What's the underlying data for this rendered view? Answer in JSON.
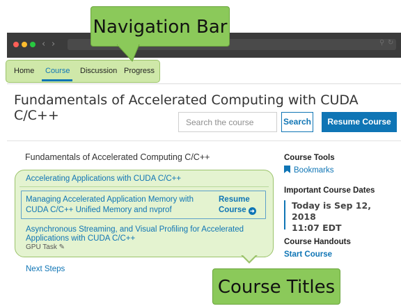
{
  "annotations": {
    "nav_callout": "Navigation Bar",
    "titles_callout": "Course Titles"
  },
  "course_nav": {
    "items": [
      {
        "label": "Home"
      },
      {
        "label": "Course"
      },
      {
        "label": "Discussion"
      },
      {
        "label": "Progress"
      }
    ],
    "active": "Course"
  },
  "page": {
    "title": "Fundamentals of Accelerated Computing with CUDA C/C++"
  },
  "search": {
    "placeholder": "Search the course",
    "button_label": "Search",
    "resume_label": "Resume Course"
  },
  "outline": {
    "title": "Fundamentals of Accelerated Computing C/C++",
    "chapters": [
      {
        "title": "Accelerating Applications with CUDA C/C++"
      },
      {
        "title": "Managing Accelerated Application Memory with CUDA C/C++ Unified Memory and nvprof",
        "resume_label": "Resume Course"
      },
      {
        "title": "Asynchronous Streaming, and Visual Profiling for Accelerated Applications with CUDA C/C++",
        "sub": "GPU Task"
      }
    ],
    "next_steps": "Next Steps"
  },
  "sidebar": {
    "tools_title": "Course Tools",
    "bookmarks": "Bookmarks",
    "dates_title": "Important Course Dates",
    "today_line1": "Today is Sep 12, 2018",
    "today_line2": "11:07 EDT",
    "handouts_title": "Course Handouts",
    "start_course": "Start Course"
  },
  "colors": {
    "accent": "#0f75b5",
    "callout": "#8bc95a",
    "highlight": "#e4f3d0",
    "titlebar": "#3b3b3b"
  }
}
